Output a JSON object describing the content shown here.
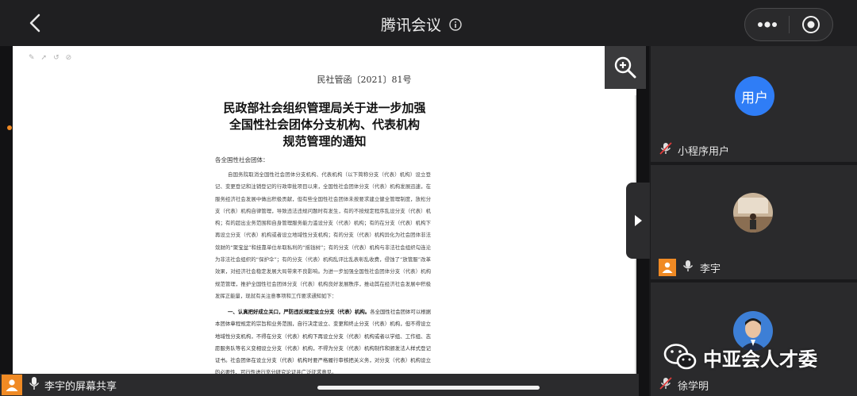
{
  "header": {
    "title": "腾讯会议",
    "back_icon": "chevron-left-icon",
    "info_icon": "info-circle-icon",
    "more_icon": "more-dots-icon",
    "record_icon": "target-circle-icon"
  },
  "document": {
    "doc_number": "民社管函〔2021〕81号",
    "title_line1": "民政部社会组织管理局关于进一步加强",
    "title_line2": "全国性社会团体分支机构、代表机构",
    "title_line3": "规范管理的通知",
    "salutation": "各全国性社会团体：",
    "body": "自国务院取消全国性社会团体分支机构、代表机构（以下简称分支（代表）机构）设立登记、变更登记和注销登记的行政审批项目以来，全国性社会团体分支（代表）机构发展迅速，在服务经济社会发展中做出积极贡献，但有些全国性社会团体未按要求建立健全管理制度，放松分支（代表）机构自律管理，导致违法违规问题时有发生，有的不按规定程序乱设分支（代表）机构；有的超出业务范围和自身管理服务能力滥设分支（代表）机构；有的在分支（代表）机构下再设立分支（代表）机构或者设立地域性分支机构；有的分支（代表）机构异化为社会团体非法敛财的“聚宝盆”和挂靠单位牟取私利的“摇钱树”；有的分支（代表）机构与非法社会组织勾连沦为非法社会组织的“保护伞”；有的分支（代表）机构乱评比乱表彰乱收费，侵蚀了“放管服”改革效果，对经济社会稳定发展大局带来不良影响。为进一步加强全国性社会团体分支（代表）机构规范管理，推护全国性社会团体分支（代表）机构良好发展秩序，推动其在经济社会发展中积极发挥正能量，现就有关注意事项和工作要求通知如下：",
    "section_head": "一、认真把好成立关口，严防违反规定设立分支（代表）机构。",
    "section_body": "各全国性社会团体可以根据本团体章程规定的宗旨和业务范围，自行决定设立、变更和终止分支（代表）机构，但不得设立地域性分支机构，不得在分支（代表）机构下再设立分支（代表）机构或者以学组、工作组、志愿服务队等名义变相设立分支（代表）机构，不得为分支（代表）机构制作和颁发法人样式登记证书。社会团体在设立分支（代表）机构时要严格履行审核把关义务，对分支（代表）机构设立的必要性、可行性进行充分研究论证并广泛征求意见。"
  },
  "participants": [
    {
      "name": "小程序用户",
      "avatar_text": "用户",
      "mic": "mic-muted-icon"
    },
    {
      "name": "李宇",
      "avatar": "photo-avatar",
      "mic": "mic-icon",
      "badge": "user-icon"
    },
    {
      "name": "徐学明",
      "avatar": "photo-avatar",
      "mic": "mic-muted-icon"
    }
  ],
  "screen_share": {
    "label": "李宇的屏幕共享",
    "user_icon": "user-icon",
    "mic_icon": "mic-icon"
  },
  "watermark": {
    "text": "中亚会人才委",
    "icon": "wechat-icon"
  },
  "colors": {
    "accent": "#f08a24",
    "avatar_blue": "#2f7df6",
    "background": "#1b1b1d"
  }
}
